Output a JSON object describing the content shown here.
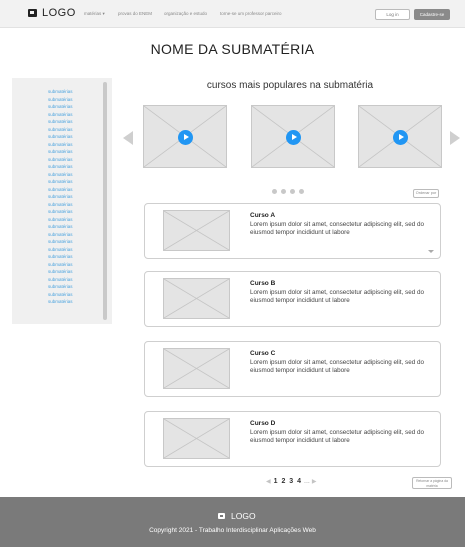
{
  "header": {
    "logo": "LOGO",
    "nav": [
      "matérias ▾",
      "provas do ENEM",
      "organização e estudo",
      "torne-se um professor parceiro"
    ],
    "login": "Log in",
    "signup": "Cadastre-se"
  },
  "page": {
    "title": "NOME DA SUBMATÉRIA",
    "section_title": "cursos mais populares na submatéria"
  },
  "sidebar": {
    "items": [
      "submatérias",
      "submatérias",
      "submatérias",
      "submatérias",
      "submatérias",
      "submatérias",
      "submatérias",
      "submatérias",
      "submatérias",
      "submatérias",
      "submatérias",
      "submatérias",
      "submatérias",
      "submatérias",
      "submatérias",
      "submatérias",
      "submatérias",
      "submatérias",
      "submatérias",
      "submatérias",
      "submatérias",
      "submatérias",
      "submatérias",
      "submatérias",
      "submatérias",
      "submatérias",
      "submatérias",
      "submatérias",
      "submatérias"
    ]
  },
  "carousel": {
    "icons": {
      "prev": "chevron-left-icon",
      "next": "chevron-right-icon",
      "play": "play-icon"
    },
    "slides": 3,
    "dots": 4
  },
  "sort_label": "Ordenar por",
  "courses": [
    {
      "title": "Curso A",
      "desc": "Lorem ipsum dolor sit amet, consectetur adipiscing elit, sed do eiusmod tempor incididunt ut labore"
    },
    {
      "title": "Curso B",
      "desc": "Lorem ipsum dolor sit amet, consectetur adipiscing elit, sed do eiusmod tempor incididunt ut labore"
    },
    {
      "title": "Curso C",
      "desc": "Lorem ipsum dolor sit amet, consectetur adipiscing elit, sed do eiusmod tempor incididunt ut labore"
    },
    {
      "title": "Curso D",
      "desc": "Lorem ipsum dolor sit amet, consectetur adipiscing elit, sed do eiusmod tempor incididunt ut labore"
    }
  ],
  "pagination": {
    "prev": "◀",
    "pages": [
      "1",
      "2",
      "3",
      "4"
    ],
    "ellipsis": "...",
    "next": "▶"
  },
  "back_label": "Retornar a página da matéria",
  "footer": {
    "logo": "LOGO",
    "copyright": "Copyright 2021 - Trabalho Interdisciplinar Aplicações Web"
  },
  "colors": {
    "accent": "#2196f3",
    "link": "#4aa3df",
    "footer_bg": "#7a7a7a"
  }
}
